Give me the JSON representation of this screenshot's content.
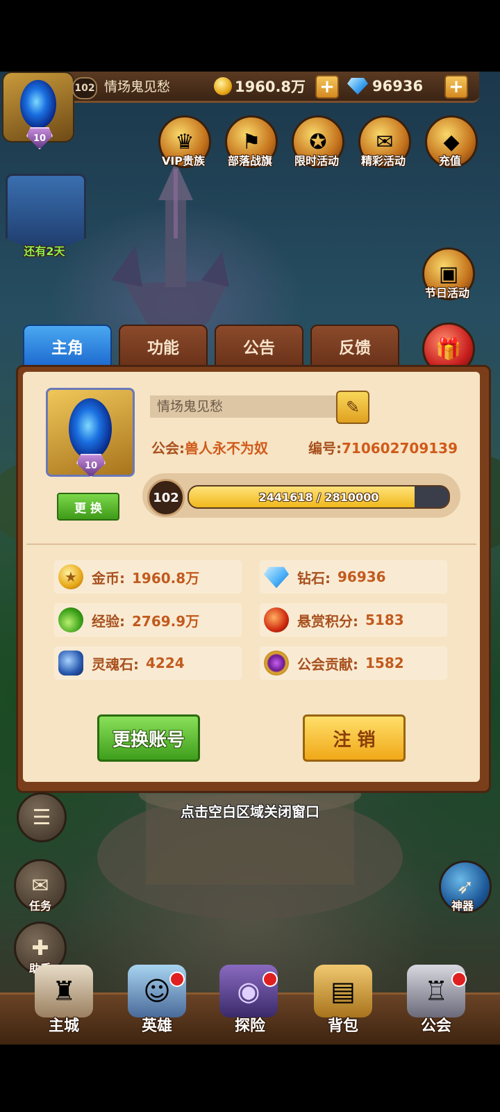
{
  "header": {
    "level": "102",
    "player_name": "情场鬼见愁",
    "gold": "1960.8万",
    "diamonds": "96936",
    "avatar_level": "10"
  },
  "top_icons": [
    {
      "label": "VIP贵族",
      "icon": "crown-icon"
    },
    {
      "label": "部落战旗",
      "icon": "lion-banner-icon"
    },
    {
      "label": "限时活动",
      "icon": "compass-icon"
    },
    {
      "label": "精彩活动",
      "icon": "scroll-icon"
    },
    {
      "label": "充值",
      "icon": "diamond-icon"
    }
  ],
  "side_left": {
    "event_label": "还有2天"
  },
  "side_right": {
    "festival_label": "节日活动"
  },
  "tabs": [
    {
      "label": "主角",
      "active": true
    },
    {
      "label": "功能",
      "active": false
    },
    {
      "label": "公告",
      "active": false
    },
    {
      "label": "反馈",
      "active": false
    }
  ],
  "profile": {
    "name_value": "情场鬼见愁",
    "avatar_level": "10",
    "change_avatar_label": "更 换",
    "guild_label": "公会:",
    "guild_value": "兽人永不为奴",
    "id_label": "编号:",
    "id_value": "710602709139",
    "level": "102",
    "xp_text": "2441618 / 2810000",
    "xp_fraction": 0.869
  },
  "stats": [
    {
      "label": "金币:",
      "value": "1960.8万",
      "icon": "gold-coin-icon"
    },
    {
      "label": "钻石:",
      "value": "96936",
      "icon": "diamond-icon"
    },
    {
      "label": "经验:",
      "value": "2769.9万",
      "icon": "potion-icon"
    },
    {
      "label": "悬赏积分:",
      "value": "5183",
      "icon": "bounty-badge-icon"
    },
    {
      "label": "灵魂石:",
      "value": "4224",
      "icon": "soul-stone-icon"
    },
    {
      "label": "公会贡献:",
      "value": "1582",
      "icon": "guild-crest-icon"
    }
  ],
  "buttons": {
    "switch_account": "更换账号",
    "logout": "注 销"
  },
  "hint": "点击空白区域关闭窗口",
  "left_menu": [
    {
      "label": "",
      "icon": "chat-icon"
    },
    {
      "label": "任务",
      "icon": "task-scroll-icon"
    },
    {
      "label": "助手",
      "icon": "gift-icon"
    }
  ],
  "right_menu": {
    "label": "神器"
  },
  "bottom_nav": [
    {
      "label": "主城",
      "icon": "castle-icon"
    },
    {
      "label": "英雄",
      "icon": "hero-icon"
    },
    {
      "label": "探险",
      "icon": "portal-icon"
    },
    {
      "label": "背包",
      "icon": "backpack-icon"
    },
    {
      "label": "公会",
      "icon": "guild-tower-icon"
    }
  ],
  "colors": {
    "accent_orange": "#a8501e",
    "tab_active": "#1d6ad0",
    "panel_bg": "#f6e4c4"
  }
}
